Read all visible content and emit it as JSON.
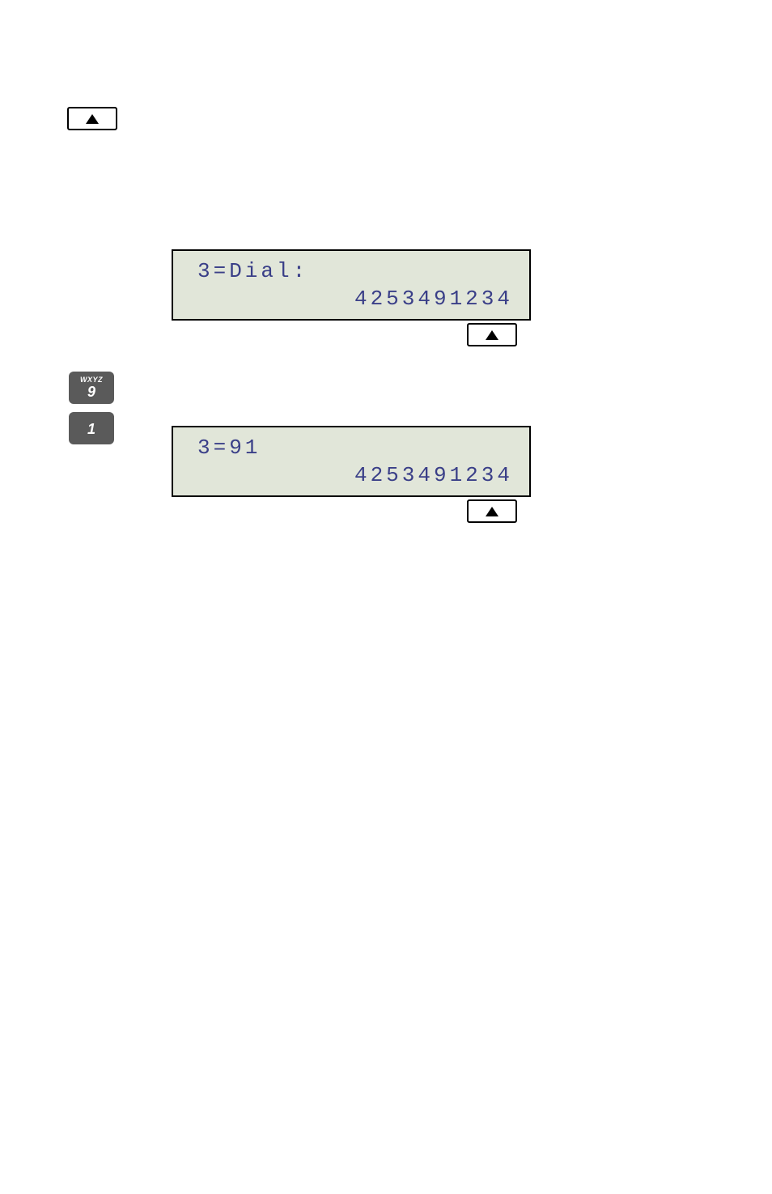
{
  "lcd1": {
    "line1": "3=Dial:",
    "line2": "4253491234"
  },
  "lcd2": {
    "line1": "3=91",
    "line2": "4253491234"
  },
  "keys": {
    "key9": {
      "letters": "WXYZ",
      "digit": "9"
    },
    "key1": {
      "letters": "",
      "digit": "1"
    }
  }
}
